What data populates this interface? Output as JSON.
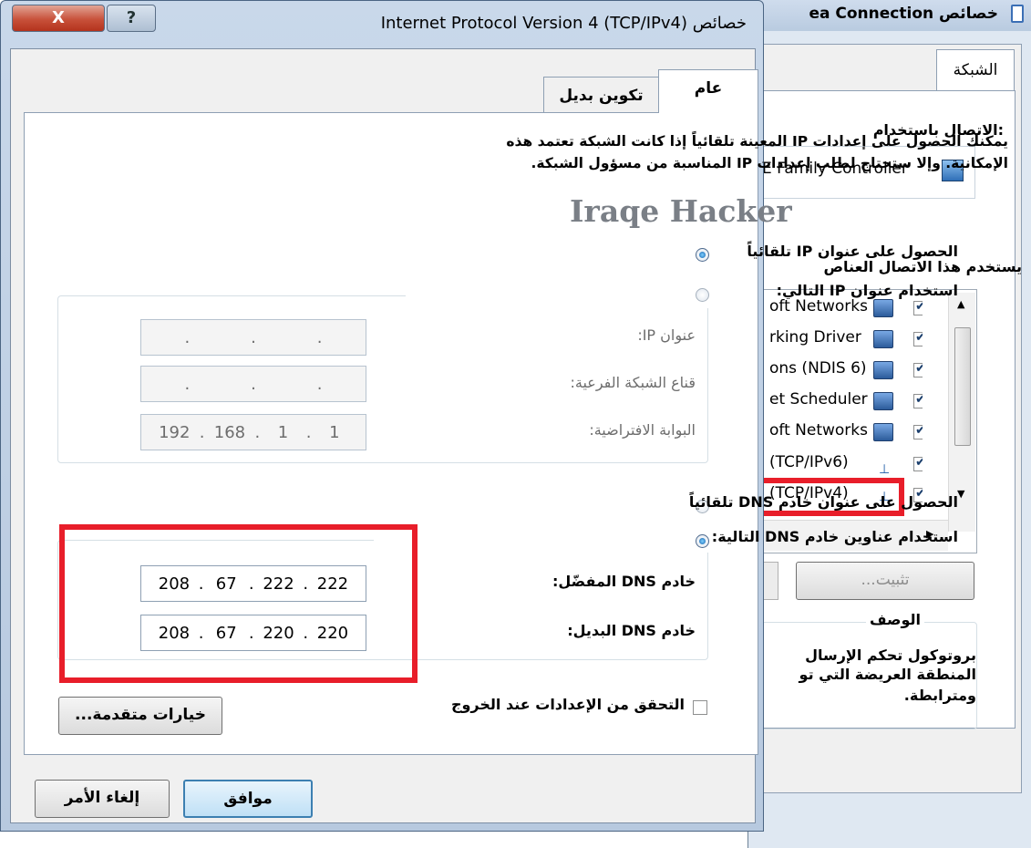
{
  "background_window": {
    "title": "خصائص ea Connection",
    "tab": "الشبكة",
    "connect_using_label": ":الاتصال باستخدام",
    "adapter": "E Family Controller",
    "items_label": "يستخدم هذا الاتصال العناص",
    "items": [
      {
        "label": "oft Networks",
        "checked": true
      },
      {
        "label": "rking Driver",
        "checked": true
      },
      {
        "label": "ons (NDIS 6)",
        "checked": true
      },
      {
        "label": "et Scheduler",
        "checked": true
      },
      {
        "label": "oft Networks",
        "checked": true
      },
      {
        "label": "(TCP/IPv6)",
        "checked": true
      },
      {
        "label": "(TCP/IPv4)",
        "checked": true
      }
    ],
    "install_button": "تثبيت...",
    "description_label": "الوصف",
    "description_text": [
      "بروتوكول تحكم الإرسال",
      "المنطقة العريضة التي تو",
      "ومترابطة."
    ]
  },
  "dialog": {
    "title": "خصائص Internet Protocol Version 4 (TCP/IPv4)",
    "close_label": "X",
    "help_label": "?",
    "tabs": {
      "general": "عام",
      "alternate": "تكوين بديل"
    },
    "intro_line1": "يمكنك الحصول على إعدادات IP المعينة تلقائياً إذا كانت الشبكة تعتمد هذه",
    "intro_line2": "الإمكانية. وإلا ستحتاج لطلب إعدادات IP المناسبة من مسؤول الشبكة.",
    "ip_auto_label": "الحصول على عنوان IP تلقائياً",
    "ip_manual_label": "استخدام عنوان IP التالي:",
    "ip_address_label": "عنوان IP:",
    "subnet_label": "قناع الشبكة الفرعية:",
    "gateway_label": "البوابة الافتراضية:",
    "gateway_value": [
      "192",
      "168",
      "1",
      "1"
    ],
    "dns_auto_label": "الحصول على عنوان خادم DNS تلقائياً",
    "dns_manual_label": "استخدام عناوين خادم DNS التالية:",
    "preferred_dns_label": "خادم DNS المفضّل:",
    "alternate_dns_label": "خادم DNS البديل:",
    "preferred_dns_value": [
      "208",
      "67",
      "222",
      "222"
    ],
    "alternate_dns_value": [
      "208",
      "67",
      "220",
      "220"
    ],
    "validate_label": "التحقق من الإعدادات عند الخروج",
    "validate_checked": false,
    "advanced_button": "خيارات متقدمة...",
    "ok_button": "موافق",
    "cancel_button": "إلغاء الأمر"
  },
  "watermark": "Iraqe Hacker",
  "colors": {
    "highlight_red": "#e81e2a",
    "title_bar": "#c9d8ea",
    "close_button": "#c8513a"
  }
}
